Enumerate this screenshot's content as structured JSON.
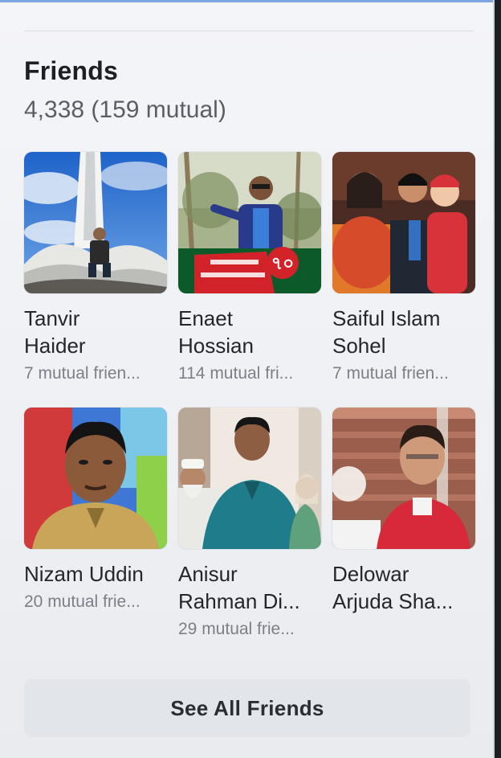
{
  "section": {
    "title": "Friends",
    "count_text": "4,338 (159 mutual)"
  },
  "friends": [
    {
      "name": "Tanvir\nHaider",
      "mutual": "7 mutual frien..."
    },
    {
      "name": "Enaet\nHossian",
      "mutual": "114 mutual fri...",
      "photo_banner_text": "৭০"
    },
    {
      "name": "Saiful Islam\nSohel",
      "mutual": "7 mutual frien..."
    },
    {
      "name": "Nizam Uddin",
      "mutual": "20 mutual frie..."
    },
    {
      "name": "Anisur\nRahman Di...",
      "mutual": "29 mutual frie..."
    },
    {
      "name": "Delowar\nArjuda Sha...",
      "mutual": ""
    }
  ],
  "footer": {
    "see_all_label": "See All Friends"
  },
  "colors": {
    "accent": "#2f6fd1",
    "text_primary": "#23262b",
    "text_secondary": "#7b7f87",
    "button_bg": "#e2e5ea"
  }
}
